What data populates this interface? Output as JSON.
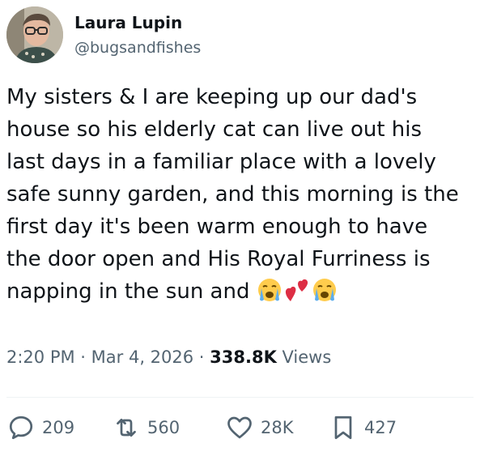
{
  "author": {
    "display_name": "Laura Lupin",
    "handle": "@bugsandfishes",
    "avatar_icon": "profile-photo"
  },
  "tweet": {
    "text": "My sisters & I are keeping up our dad's\nhouse so his elderly cat can live out his\nlast days in a familiar place with a lovely\nsafe sunny garden, and this morning is the\nfirst day it's been warm enough to have\nthe door open and His Royal Furriness is\nnapping in the sun and ",
    "emojis": [
      "crying-face",
      "two-hearts",
      "crying-face"
    ]
  },
  "meta": {
    "time": "2:20 PM",
    "separator1": " · ",
    "date": "Mar 4, 2026",
    "separator2": " · ",
    "views_count": "338.8K",
    "views_label": " Views"
  },
  "actions": {
    "replies": "209",
    "reposts": "560",
    "likes": "28K",
    "bookmarks": "427"
  },
  "colors": {
    "text": "#0f1419",
    "secondary": "#536471",
    "divider": "#eff3f4"
  }
}
